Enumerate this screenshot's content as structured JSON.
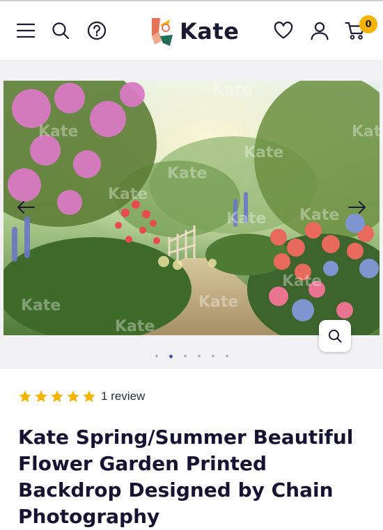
{
  "header": {
    "brand": "Kate",
    "cart_count": "0",
    "icons": [
      "menu-icon",
      "search-icon",
      "help-icon",
      "wishlist-icon",
      "account-icon",
      "cart-icon"
    ]
  },
  "gallery": {
    "image_count": 6,
    "active_index": 1,
    "watermark": "Kate",
    "colors": {
      "active_dot": "#3f51b5",
      "inactive_dot": "#b5b5bd"
    }
  },
  "product": {
    "rating": 5,
    "review_text": "1 review",
    "title": "Kate Spring/Summer Beautiful Flower Garden Printed Backdrop Designed by Chain Photography"
  },
  "colors": {
    "star": "#f5b400",
    "badge": "#f5b400",
    "text": "#151433"
  }
}
